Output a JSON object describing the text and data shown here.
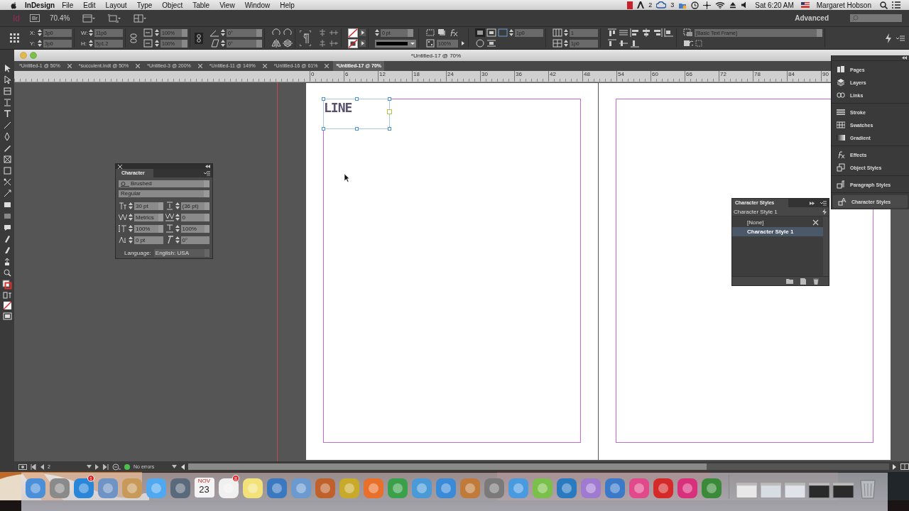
{
  "menubar": {
    "app": "InDesign",
    "menus": [
      "File",
      "Edit",
      "Layout",
      "Type",
      "Object",
      "Table",
      "View",
      "Window",
      "Help"
    ],
    "status": {
      "adobe_count": "2",
      "cc_count": "3",
      "clock": "Sat 6:20 AM",
      "user": "Margaret Hobson"
    }
  },
  "app_bar": {
    "logo": "Id",
    "bridge": "Br",
    "zoom": "70.4%",
    "workspace": "Advanced"
  },
  "control_panel": {
    "position": [
      {
        "label": "X:",
        "value": "3p0"
      },
      {
        "label": "Y:",
        "value": "3p0"
      }
    ],
    "size": [
      {
        "label": "W:",
        "value": "11p6"
      },
      {
        "label": "H:",
        "value": "5p1.2"
      }
    ],
    "scale": [
      "100%",
      "100%"
    ],
    "angles": [
      "0°",
      "0°"
    ],
    "stroke_weight": "0 pt",
    "opacity": "100%",
    "offset": "1p0",
    "columns": "1",
    "gutter": "1p0",
    "object_style": "[Basic Text Frame]"
  },
  "document": {
    "title": "*Untitled-17 @ 70%",
    "tabs": [
      {
        "label": "*Untitled-1 @ 50%",
        "selected": false
      },
      {
        "label": "*succulent.indt @ 50%",
        "selected": false
      },
      {
        "label": "*Untitled-3 @ 200%",
        "selected": false
      },
      {
        "label": "*Untitled-11 @ 149%",
        "selected": false
      },
      {
        "label": "*Untitled-16 @ 61%",
        "selected": false
      },
      {
        "label": "*Untitled-17 @ 70%",
        "selected": true
      }
    ],
    "ruler": [
      "0",
      "6",
      "12",
      "18",
      "24",
      "30",
      "36",
      "42",
      "48",
      "54",
      "60",
      "66",
      "72",
      "78",
      "84",
      "90"
    ],
    "frame_text": "LINE"
  },
  "character_panel": {
    "title": "Character",
    "font": "Brushed",
    "style": "Regular",
    "fields": [
      {
        "value": "30 pt",
        "kind": "dropdown"
      },
      {
        "value": "(36 pt)",
        "kind": "dropdown"
      },
      {
        "value": "Metrics",
        "kind": "dropdown"
      },
      {
        "value": "0",
        "kind": "dropdown"
      },
      {
        "value": "100%",
        "kind": "dropdown"
      },
      {
        "value": "100%",
        "kind": "dropdown"
      },
      {
        "value": "0 pt",
        "kind": "plain"
      },
      {
        "value": "0°",
        "kind": "plain"
      }
    ],
    "language_label": "Language:",
    "language": "English: USA"
  },
  "panel_dock": {
    "groups": [
      [
        {
          "label": "Pages",
          "selected": false
        },
        {
          "label": "Layers",
          "selected": false
        },
        {
          "label": "Links",
          "selected": false
        }
      ],
      [
        {
          "label": "Stroke",
          "selected": false
        },
        {
          "label": "Swatches",
          "selected": false
        },
        {
          "label": "Gradient",
          "selected": false
        }
      ],
      [
        {
          "label": "Effects",
          "selected": false
        },
        {
          "label": "Object Styles",
          "selected": false
        }
      ],
      [
        {
          "label": "Paragraph Styles",
          "selected": false
        }
      ],
      [
        {
          "label": "Character Styles",
          "selected": true
        }
      ]
    ]
  },
  "character_styles_panel": {
    "title": "Character Styles",
    "current": "Character Style 1",
    "styles": [
      {
        "label": "[None]",
        "selected": false
      },
      {
        "label": "Character Style 1",
        "selected": true
      }
    ]
  },
  "status_bar": {
    "page": "2",
    "preflight": "No errors"
  },
  "dock": {
    "items": [
      {
        "kind": "app",
        "color": "#4a8fd8"
      },
      {
        "kind": "app",
        "color": "#8a8a8a"
      },
      {
        "kind": "app",
        "color": "#2a86d8",
        "badge": "1"
      },
      {
        "kind": "app",
        "color": "#6f93c4"
      },
      {
        "kind": "app",
        "color": "#c89a5a"
      },
      {
        "kind": "app",
        "color": "#4fa8f0"
      },
      {
        "kind": "app",
        "color": "#5a6a7a"
      },
      {
        "kind": "calendar",
        "color": "#f4f4f4",
        "month": "NOV",
        "day": "23"
      },
      {
        "kind": "app",
        "color": "#f0f0f0",
        "badge": "8"
      },
      {
        "kind": "app",
        "color": "#f3e27a"
      },
      {
        "kind": "app",
        "color": "#3a78c0"
      },
      {
        "kind": "app",
        "color": "#6a9ad0"
      },
      {
        "kind": "app",
        "color": "#c0602a"
      },
      {
        "kind": "app",
        "color": "#c9a92a"
      },
      {
        "kind": "app",
        "color": "#e8702a"
      },
      {
        "kind": "app",
        "color": "#3aa04a"
      },
      {
        "kind": "app",
        "color": "#4a9ad8"
      },
      {
        "kind": "app",
        "color": "#3a8ad8"
      },
      {
        "kind": "app",
        "color": "#c07a3a"
      },
      {
        "kind": "app",
        "color": "#7a7a7a"
      },
      {
        "kind": "app",
        "color": "#4a9ae0"
      },
      {
        "kind": "app",
        "color": "#7ac04a"
      },
      {
        "kind": "app",
        "color": "#2a7ac0"
      },
      {
        "kind": "app",
        "color": "#a07ad0"
      },
      {
        "kind": "app",
        "color": "#3a7ac8"
      },
      {
        "kind": "app",
        "color": "#e04a8a"
      },
      {
        "kind": "app",
        "color": "#d42a2a"
      },
      {
        "kind": "app",
        "color": "#d8307a"
      },
      {
        "kind": "app",
        "color": "#3a8a3a"
      },
      {
        "kind": "doc",
        "color": "#e8e8e8"
      },
      {
        "kind": "doc",
        "color": "#d8dde4"
      },
      {
        "kind": "doc",
        "color": "#e0e4ea"
      },
      {
        "kind": "doc",
        "color": "#2a2a2a"
      },
      {
        "kind": "doc",
        "color": "#2a2a2a"
      },
      {
        "kind": "trash",
        "color": "#b8bcc0"
      }
    ]
  }
}
